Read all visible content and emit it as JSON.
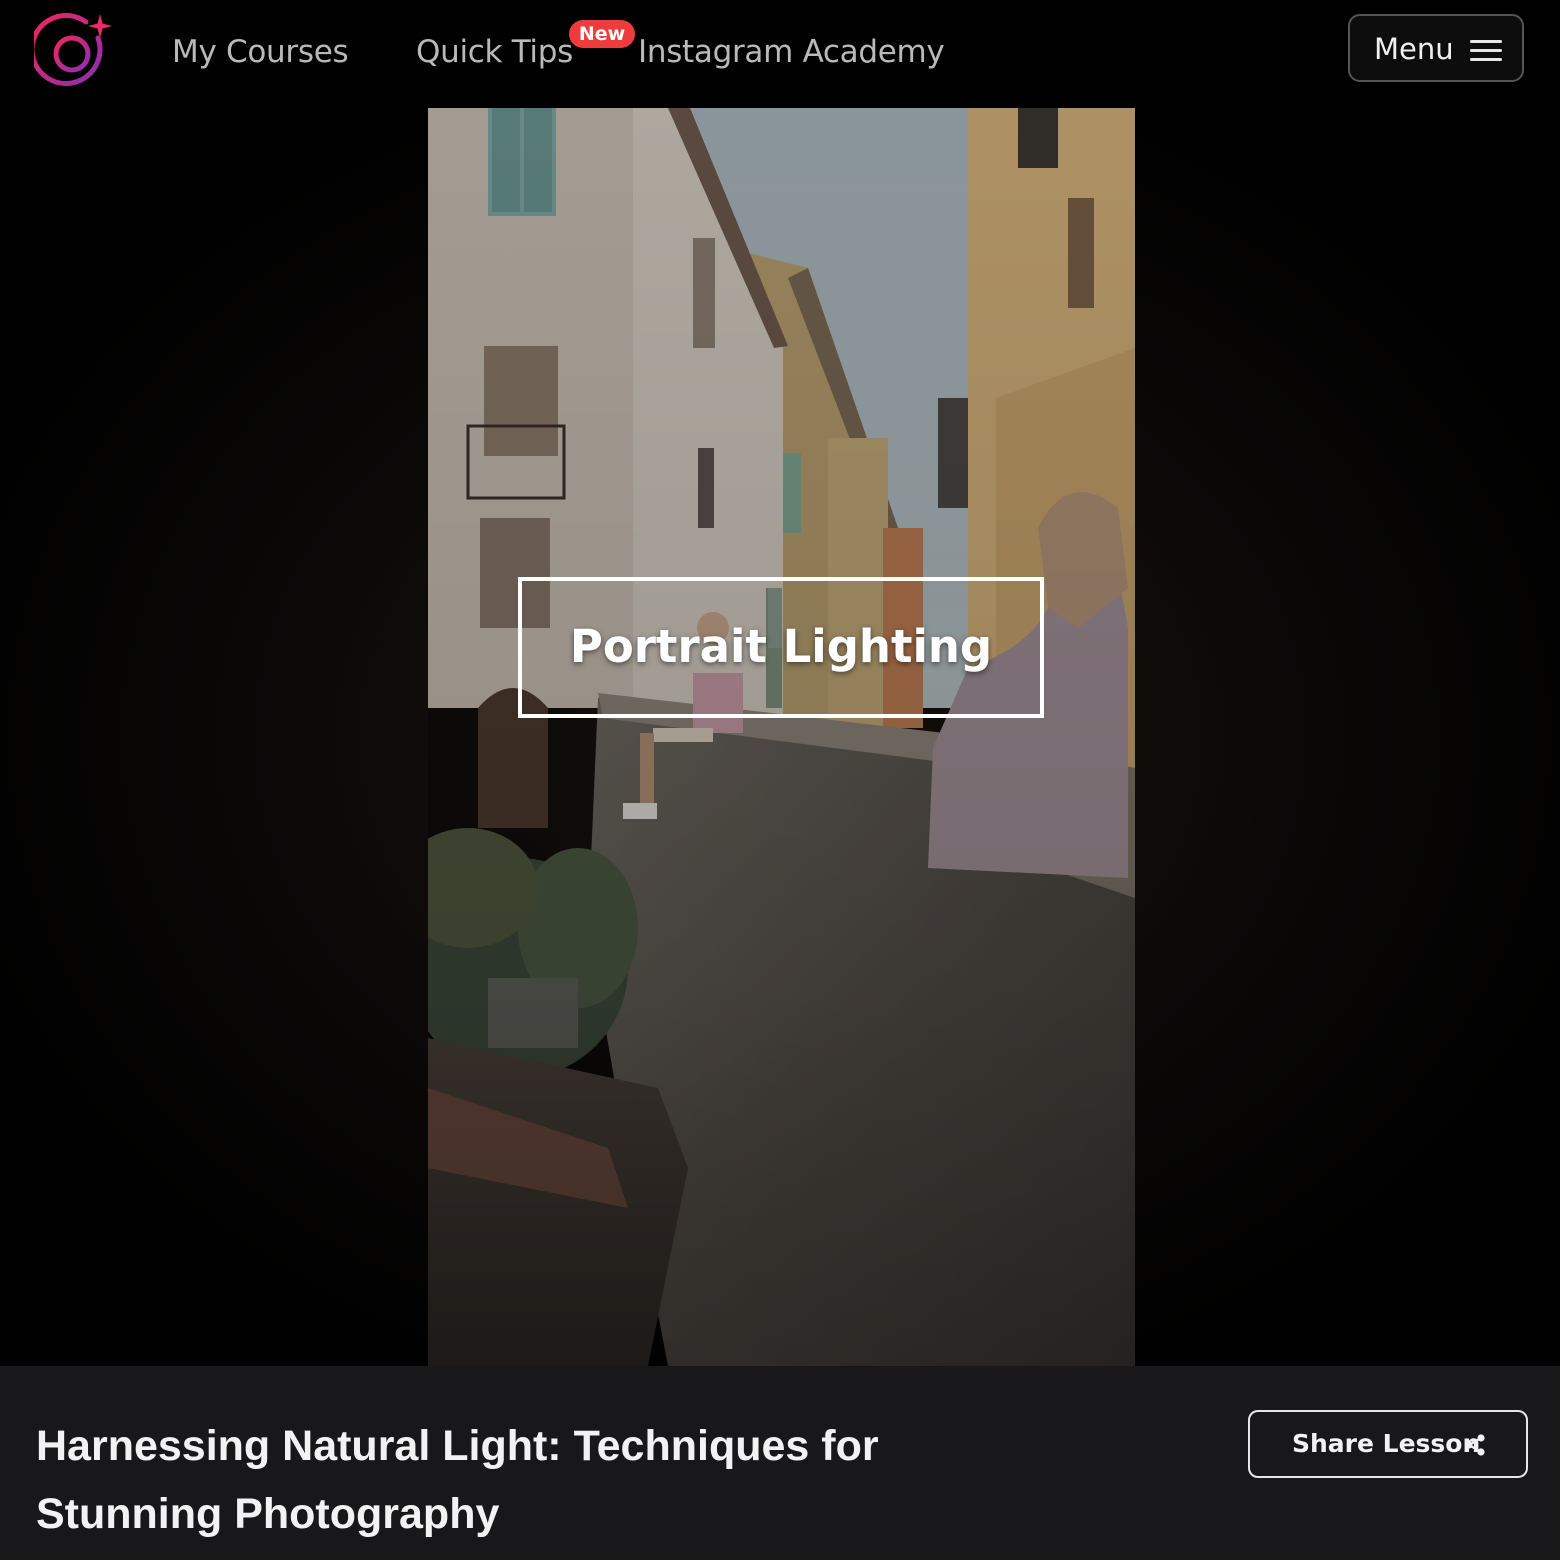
{
  "nav": {
    "logo_icon": "camera-lens-sparkle-icon",
    "links": [
      {
        "label": "My Courses"
      },
      {
        "label": "Quick Tips",
        "badge": "New"
      },
      {
        "label": "Instagram Academy"
      }
    ],
    "menu": {
      "label": "Menu",
      "icon": "hamburger-icon"
    }
  },
  "video": {
    "overlay_title": "Portrait Lighting"
  },
  "lesson": {
    "title": "Harnessing Natural Light: Techniques for Stunning Photography",
    "share_label": "Share Lesson",
    "share_icon": "share-icon"
  },
  "colors": {
    "badge": "#ef3b3b",
    "logo_gradient_start": "#e1306c",
    "logo_gradient_end": "#833ab4",
    "info_bar_bg": "#18181a"
  }
}
